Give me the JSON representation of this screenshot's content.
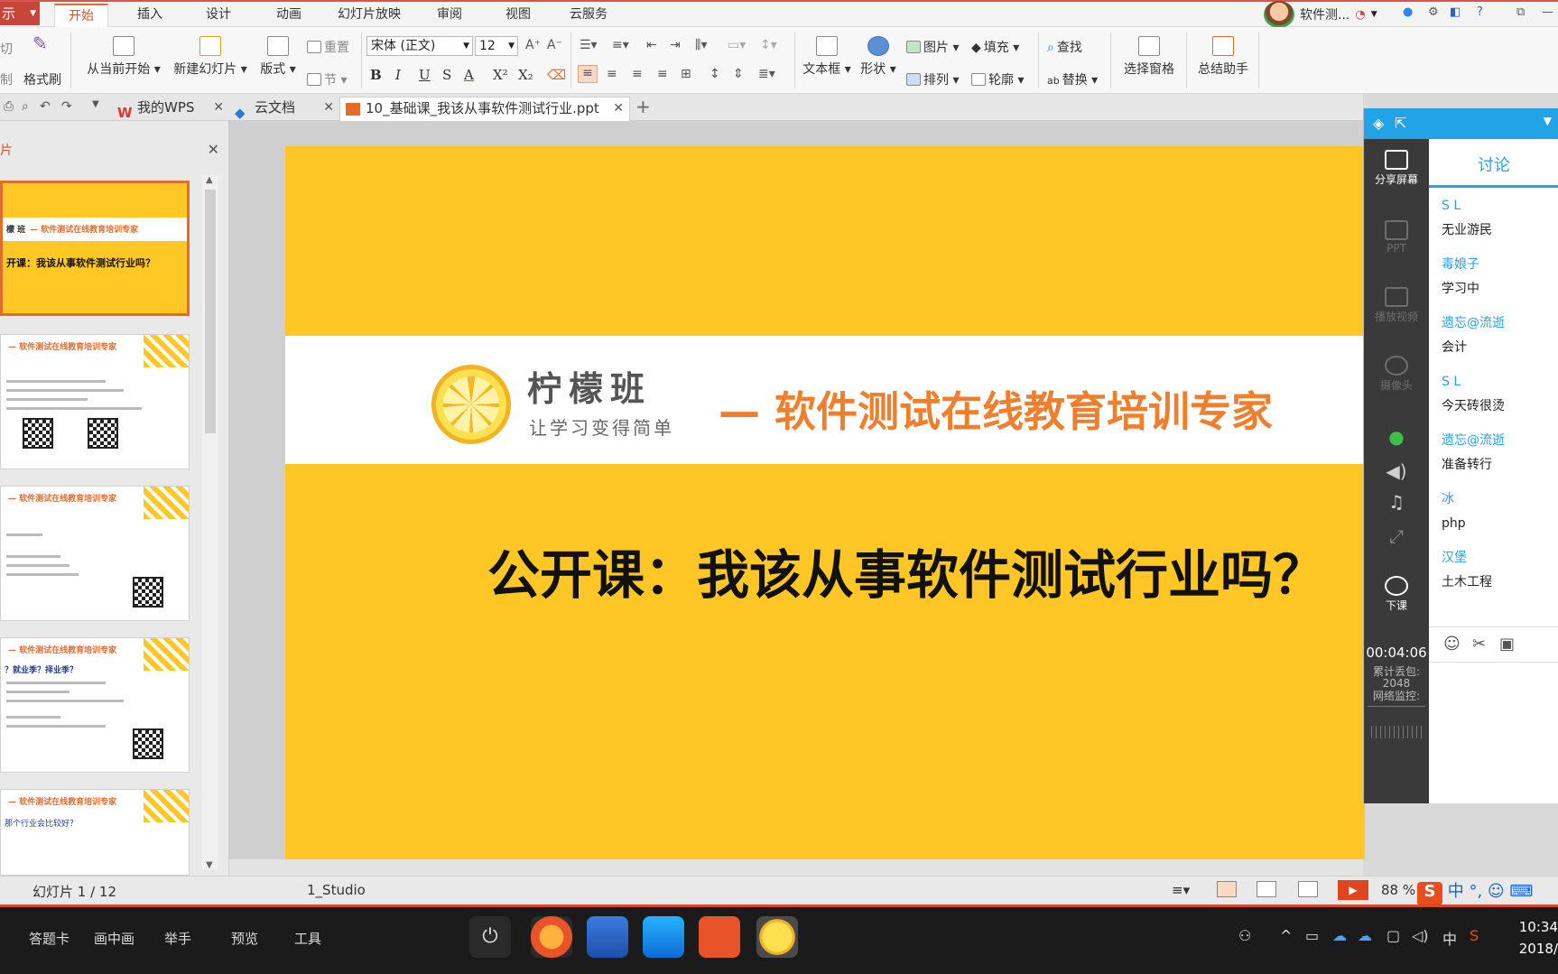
{
  "menubar": {
    "app_button": "示",
    "tabs": [
      "开始",
      "插入",
      "设计",
      "动画",
      "幻灯片放映",
      "审阅",
      "视图",
      "云服务"
    ],
    "active_tab": "开始",
    "user_name": "软件测..."
  },
  "ribbon": {
    "cut": "切",
    "copy": "制",
    "format_painter": "格式刷",
    "from_current": "从当前开始",
    "new_slide": "新建幻灯片",
    "layout": "版式",
    "reset": "重置",
    "section": "节",
    "font_name": "宋体 (正文)",
    "font_size": "12",
    "text_box": "文本框",
    "shape": "形状",
    "picture": "图片",
    "fill": "填充",
    "find": "查找",
    "arrange": "排列",
    "outline": "轮廓",
    "replace": "替换",
    "select_pane": "选择窗格",
    "summary_helper": "总结助手"
  },
  "tabs": [
    {
      "label": "我的WPS"
    },
    {
      "label": "云文档"
    },
    {
      "label": "10_基础课_我该从事软件测试行业.ppt"
    }
  ],
  "leftpanel": {
    "title": "片",
    "thumb1_head": "— 软件测试在线教育培训专家",
    "thumb1_logo": "檬 班",
    "thumb1_title": "开课：我该从事软件测试行业吗？",
    "thumb_head": "— 软件测试在线教育培训专家",
    "thumb4_q": "？就业季？择业季？",
    "thumb5_q": "那个行业会比较好？"
  },
  "slide": {
    "logo_name": "柠檬班",
    "logo_slogan": "让学习变得简单",
    "tagline": "—  软件测试在线教育培训专家",
    "title": "公开课：我该从事软件测试行业吗？"
  },
  "sidepanel": {
    "rail": {
      "share_screen": "分享屏幕",
      "ppt": "PPT",
      "play_video": "播放视频",
      "camera": "摄像头",
      "end_class": "下课",
      "timer": "00:04:06",
      "packet_loss_label": "累计丢包:",
      "packet_loss_value": "2048",
      "network_label": "网络监控:"
    },
    "tab": "讨论",
    "chat": [
      {
        "name": "S L",
        "msg": "无业游民"
      },
      {
        "name": "毒娘子",
        "msg": "学习中"
      },
      {
        "name": "遗忘@流逝",
        "msg": "会计"
      },
      {
        "name": "S L",
        "msg": "今天砖很烫"
      },
      {
        "name": "遗忘@流逝",
        "msg": "准备转行"
      },
      {
        "name": "冰",
        "msg": "php"
      },
      {
        "name": "汉堡",
        "msg": "土木工程"
      }
    ]
  },
  "statusbar": {
    "slide_count": "幻灯片 1 / 12",
    "theme": "1_Studio",
    "zoom": "88 %"
  },
  "taskbar": {
    "items": [
      "答题卡",
      "画中画",
      "举手",
      "预览",
      "工具"
    ],
    "ime": "中",
    "time": "10:34",
    "date": "2018/"
  },
  "colors": {
    "accent_orange": "#e46c2b",
    "slide_yellow": "#fec726",
    "chat_blue": "#2aa0e6"
  }
}
